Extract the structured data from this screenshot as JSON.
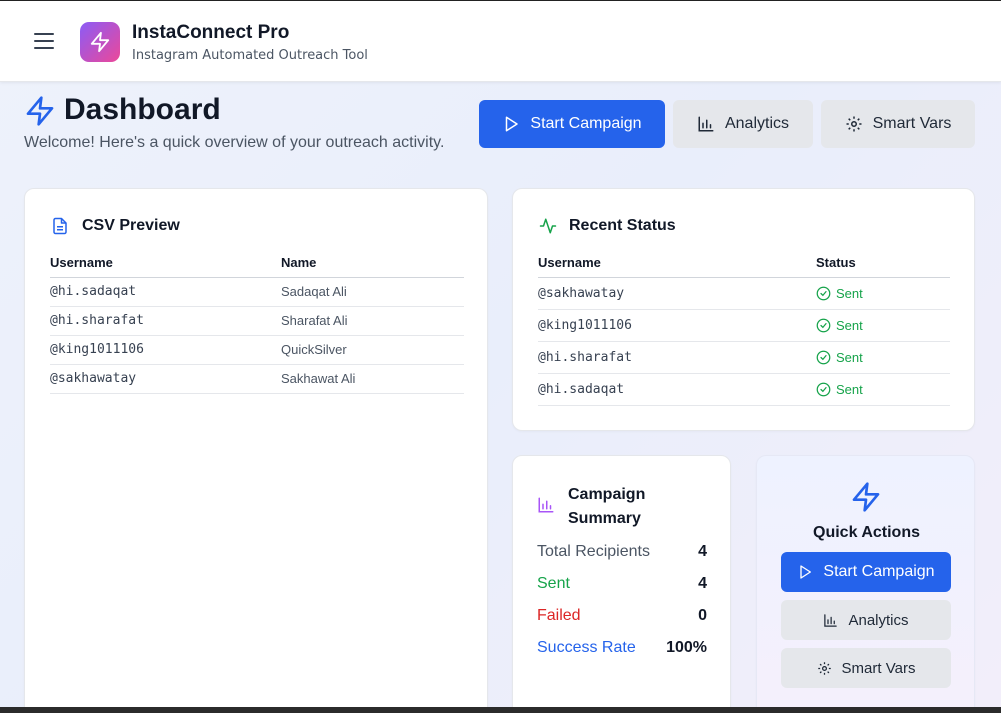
{
  "app": {
    "title": "InstaConnect Pro",
    "subtitle": "Instagram Automated Outreach Tool"
  },
  "dashboard": {
    "title": "Dashboard",
    "subtitle": "Welcome! Here's a quick overview of your outreach activity.",
    "buttons": {
      "start_campaign": "Start Campaign",
      "analytics": "Analytics",
      "smart_vars": "Smart Vars"
    }
  },
  "csv_preview": {
    "title": "CSV Preview",
    "columns": [
      "Username",
      "Name"
    ],
    "rows": [
      {
        "username": "@hi.sadaqat",
        "name": "Sadaqat Ali"
      },
      {
        "username": "@hi.sharafat",
        "name": "Sharafat Ali"
      },
      {
        "username": "@king1011106",
        "name": "QuickSilver"
      },
      {
        "username": "@sakhawatay",
        "name": "Sakhawat Ali"
      }
    ]
  },
  "recent_status": {
    "title": "Recent Status",
    "columns": [
      "Username",
      "Status"
    ],
    "rows": [
      {
        "username": "@sakhawatay",
        "status": "Sent"
      },
      {
        "username": "@king1011106",
        "status": "Sent"
      },
      {
        "username": "@hi.sharafat",
        "status": "Sent"
      },
      {
        "username": "@hi.sadaqat",
        "status": "Sent"
      }
    ]
  },
  "campaign_summary": {
    "title_line1": "Campaign",
    "title_line2": "Summary",
    "rows": [
      {
        "label": "Total Recipients",
        "value": "4",
        "color": "#4b5563"
      },
      {
        "label": "Sent",
        "value": "4",
        "color": "#16a34a"
      },
      {
        "label": "Failed",
        "value": "0",
        "color": "#dc2626"
      },
      {
        "label": "Success Rate",
        "value": "100%",
        "color": "#2563eb"
      }
    ]
  },
  "quick_actions": {
    "title": "Quick Actions",
    "start_campaign": "Start Campaign",
    "analytics": "Analytics",
    "smart_vars": "Smart Vars"
  },
  "colors": {
    "primary": "#2563eb",
    "success": "#16a34a",
    "danger": "#dc2626",
    "logo_gradient_start": "#8b5cf6",
    "logo_gradient_end": "#ec4899"
  },
  "icons": {
    "menu": "hamburger-icon",
    "logo": "lightning-icon",
    "dashboard": "lightning-icon",
    "start": "play-icon",
    "analytics": "bar-chart-icon",
    "smart_vars": "gear-icon",
    "csv": "document-icon",
    "status": "activity-icon",
    "sent": "check-circle-icon",
    "summary": "bar-chart-icon",
    "quick_actions": "lightning-icon"
  }
}
